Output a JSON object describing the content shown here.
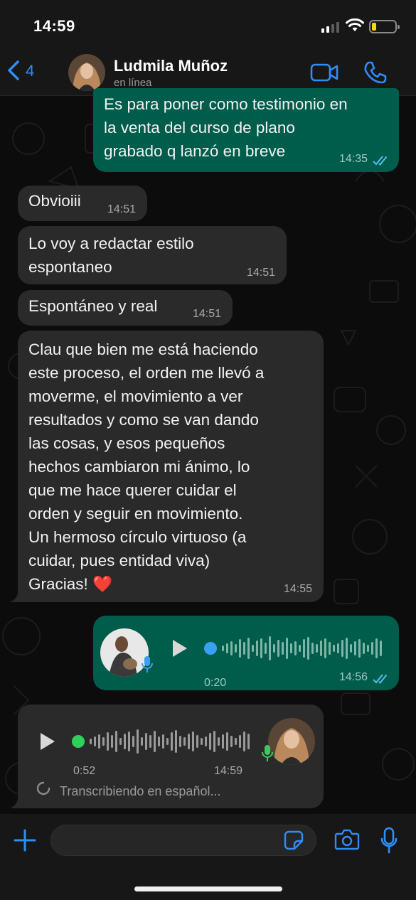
{
  "status_bar": {
    "time": "14:59",
    "battery_level": 0.2
  },
  "header": {
    "back_count": "4",
    "contact_name": "Ludmila Muñoz",
    "contact_status": "en línea",
    "icons": [
      "chevron-left-icon",
      "video-call-icon",
      "phone-call-icon"
    ]
  },
  "messages": [
    {
      "direction": "out",
      "text": "Es para poner como testimonio en\nla venta del curso de plano\ngrabado q lanzó en breve",
      "time": "14:35",
      "read": true
    },
    {
      "direction": "in",
      "text": "Obvioiii",
      "time": "14:51"
    },
    {
      "direction": "in",
      "text": "Lo voy a redactar estilo\nespontaneo",
      "time": "14:51"
    },
    {
      "direction": "in",
      "text": "Espontáneo y real",
      "time": "14:51"
    },
    {
      "direction": "in",
      "text": "Clau que bien me está haciendo\neste proceso, el orden me llevó a\nmoverme, el movimiento  a ver\nresultados y como se van dando\nlas cosas, y esos pequeños\nhechos cambiaron mi ánimo, lo\nque me hace querer cuidar el\norden y seguir en movimiento.\nUn hermoso círculo virtuoso (a\ncuidar, pues entidad viva)\nGracias! ❤️",
      "time": "14:55"
    }
  ],
  "voice_out": {
    "duration": "0:20",
    "time": "14:56",
    "read": true,
    "progress": 0
  },
  "voice_in": {
    "duration": "0:52",
    "time": "14:59",
    "progress": 0,
    "transcription": "Transcribiendo en español..."
  },
  "colors": {
    "accent": "#2f8df6",
    "bubble_out": "#005c4b",
    "bubble_in": "#2a2a2a",
    "read_ticks": "#53bdeb",
    "voice_played_dot": "#3aa0f5",
    "voice_unplayed_dot": "#2fd05e"
  }
}
